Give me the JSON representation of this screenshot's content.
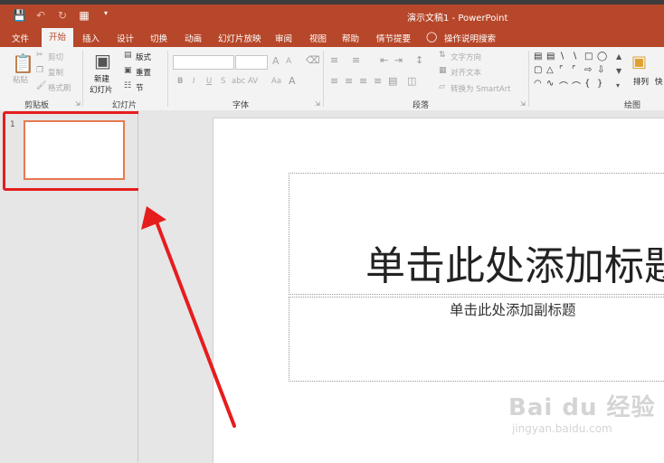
{
  "app": {
    "title": "演示文稿1  -  PowerPoint"
  },
  "qat": {
    "save_icon": "save-icon",
    "undo_icon": "undo-icon",
    "redo_icon": "redo-icon",
    "present_icon": "start-from-beginning-icon",
    "customize_icon": "customize-qat-icon"
  },
  "tabs": [
    {
      "label": "文件"
    },
    {
      "label": "开始"
    },
    {
      "label": "插入"
    },
    {
      "label": "设计"
    },
    {
      "label": "切换"
    },
    {
      "label": "动画"
    },
    {
      "label": "幻灯片放映"
    },
    {
      "label": "审阅"
    },
    {
      "label": "视图"
    },
    {
      "label": "帮助"
    },
    {
      "label": "情节提要"
    }
  ],
  "tellme": {
    "label": "操作说明搜索",
    "icon": "lightbulb-icon"
  },
  "ribbon": {
    "clipboard": {
      "label": "剪贴板",
      "paste": "粘贴",
      "cut": "剪切",
      "copy": "复制",
      "format_painter": "格式刷"
    },
    "slides": {
      "label": "幻灯片",
      "new_slide_1": "新建",
      "new_slide_2": "幻灯片",
      "layout": "版式",
      "reset": "重置",
      "section": "节"
    },
    "font": {
      "label": "字体",
      "bold": "B",
      "italic": "I",
      "underline": "U",
      "strike": "S",
      "shadow": "abc",
      "spacing": "AV",
      "case": "Aa",
      "grow": "A",
      "shrink": "A"
    },
    "paragraph": {
      "label": "段落",
      "text_direction": "文字方向",
      "align_text": "对齐文本",
      "smartart": "转换为 SmartArt"
    },
    "drawing": {
      "label": "绘图",
      "arrange": "排列",
      "quick_styles": "快"
    }
  },
  "thumbnails": [
    {
      "number": "1"
    }
  ],
  "slide": {
    "title_placeholder": "单击此处添加标题",
    "subtitle_placeholder": "单击此处添加副标题"
  },
  "annotation": {
    "color": "#e61d1d"
  },
  "watermark": {
    "brand": "Bai du 经验",
    "url": "jingyan.baidu.com"
  },
  "colors": {
    "accent": "#b7472a",
    "thumb_border": "#e7794f"
  }
}
